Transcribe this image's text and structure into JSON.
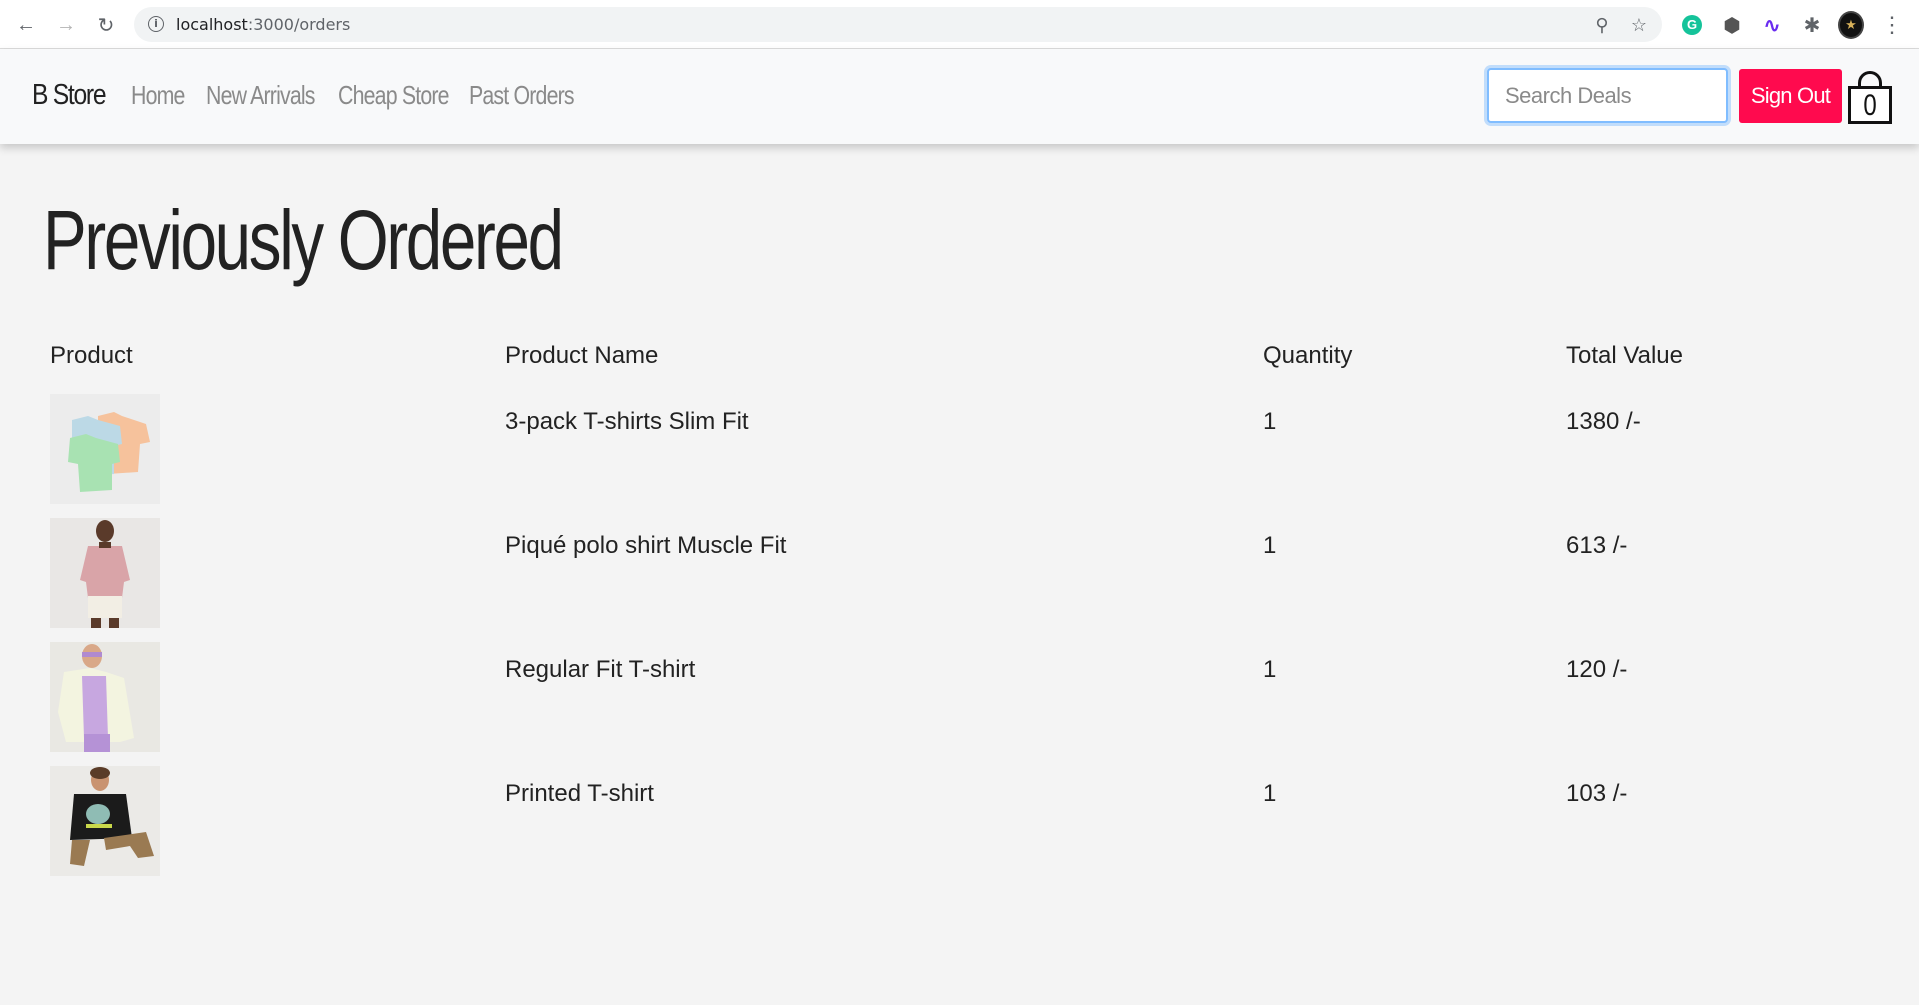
{
  "browser": {
    "url_host": "localhost",
    "url_path": ":3000/orders"
  },
  "navbar": {
    "brand": "B Store",
    "links": [
      "Home",
      "New Arrivals",
      "Cheap Store",
      "Past Orders"
    ],
    "search_placeholder": "Search Deals",
    "signout_label": "Sign Out",
    "cart_count": "0"
  },
  "page": {
    "title": "Previously Ordered"
  },
  "table": {
    "headers": [
      "Product",
      "Product Name",
      "Quantity",
      "Total Value"
    ],
    "rows": [
      {
        "name": "3-pack T-shirts Slim Fit",
        "quantity": "1",
        "total": "1380 /-"
      },
      {
        "name": "Piqué polo shirt Muscle Fit",
        "quantity": "1",
        "total": "613 /-"
      },
      {
        "name": "Regular Fit T-shirt",
        "quantity": "1",
        "total": "120 /-"
      },
      {
        "name": "Printed T-shirt",
        "quantity": "1",
        "total": "103 /-"
      }
    ]
  },
  "colors": {
    "signout_bg": "#ff0a4e",
    "search_focus": "#80bdff",
    "page_bg": "#f4f4f4",
    "navbar_bg": "#f8f9fa"
  }
}
